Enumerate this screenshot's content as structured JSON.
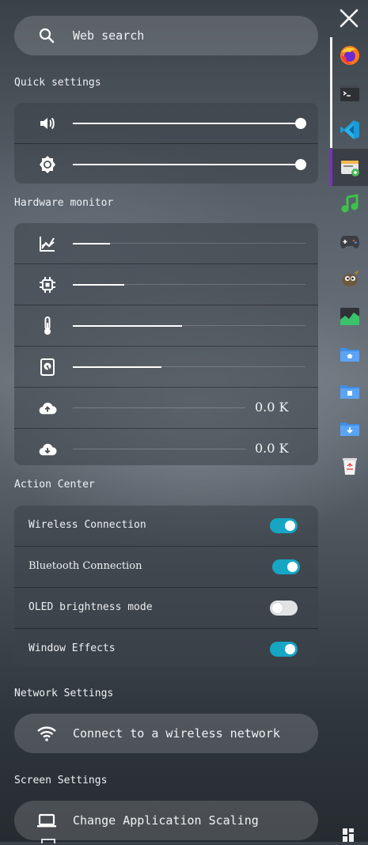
{
  "search": {
    "placeholder": "Web search"
  },
  "quick_settings": {
    "title": "Quick settings",
    "volume": 1.0,
    "brightness": 1.0
  },
  "hardware_monitor": {
    "title": "Hardware monitor",
    "cpu_graph": 0.16,
    "cpu": 0.22,
    "temperature": 0.47,
    "disk": 0.38,
    "upload": "0.0 K",
    "download": "0.0 K"
  },
  "action_center": {
    "title": "Action Center",
    "items": [
      {
        "label": "Wireless Connection",
        "on": true
      },
      {
        "label": "Bluetooth Connection",
        "on": true
      },
      {
        "label": "OLED brightness mode",
        "on": false
      },
      {
        "label": "Window Effects",
        "on": true
      }
    ]
  },
  "network_settings": {
    "title": "Network Settings",
    "button": "Connect to a wireless network"
  },
  "screen_settings": {
    "title": "Screen Settings",
    "button": "Change Application Scaling"
  },
  "dock": {
    "items": [
      "firefox-icon",
      "terminal-icon",
      "vscode-icon",
      "software-center-icon",
      "music-player-icon",
      "games-icon",
      "gimp-icon",
      "system-monitor-icon",
      "home-folder-icon",
      "documents-folder-icon",
      "downloads-folder-icon",
      "trash-icon"
    ]
  },
  "colors": {
    "accent": "#16a6c4",
    "dock_active": "#7b2fbf"
  }
}
